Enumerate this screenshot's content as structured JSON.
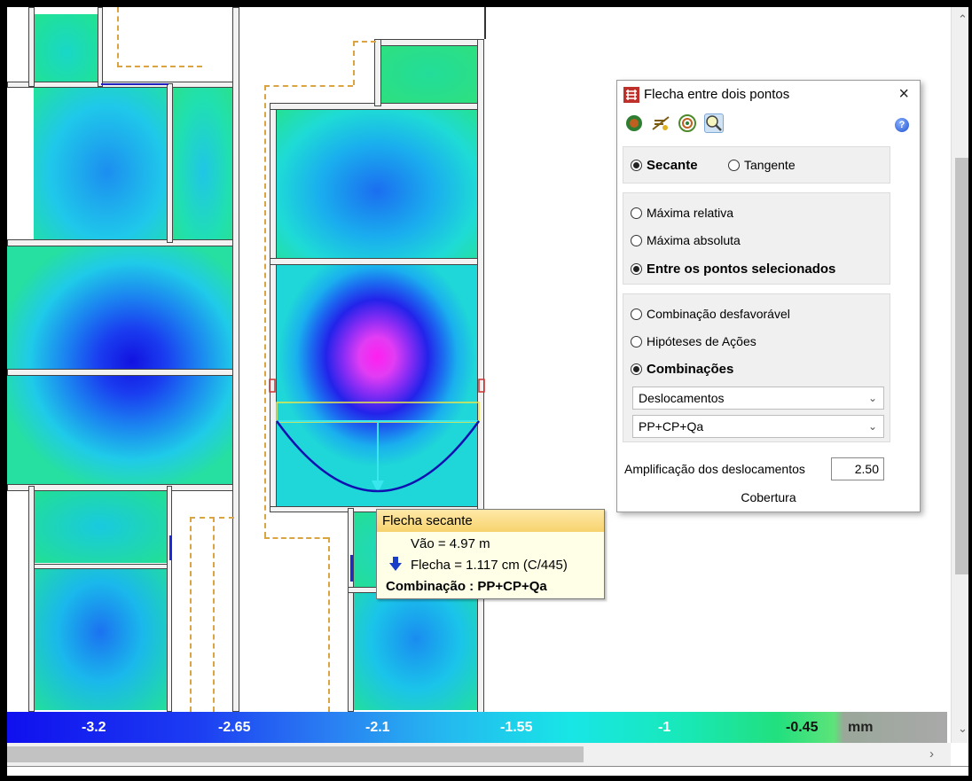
{
  "colorbar": {
    "labels": [
      "-3.2",
      "-2.65",
      "-2.1",
      "-1.55",
      "-1",
      "-0.45"
    ],
    "unit": "mm"
  },
  "tooltip": {
    "title": "Flecha secante",
    "span": "Vão = 4.97 m",
    "deflection": "Flecha = 1.117 cm (C/445)",
    "combination": "Combinação : PP+CP+Qa",
    "icon": "down-arrow-icon"
  },
  "dialog": {
    "title": "Flecha entre dois pontos",
    "close": "×",
    "help": "?",
    "toolbar_icons": [
      "deflection-map-icon",
      "beam-deflection-icon",
      "contour-icon",
      "zoom-deflection-icon"
    ],
    "method": {
      "options": [
        "Secante",
        "Tangente"
      ],
      "selected": "Secante"
    },
    "mode": {
      "options": [
        "Máxima relativa",
        "Máxima absoluta",
        "Entre os pontos selecionados"
      ],
      "selected": "Entre os pontos selecionados"
    },
    "source": {
      "options": [
        "Combinação desfavorável",
        "Hipóteses de Ações",
        "Combinações"
      ],
      "selected": "Combinações"
    },
    "result_select": "Deslocamentos",
    "combination_select": "PP+CP+Qa",
    "amplification_label": "Amplificação dos deslocamentos",
    "amplification_value": "2.50",
    "floor": "Cobertura"
  }
}
